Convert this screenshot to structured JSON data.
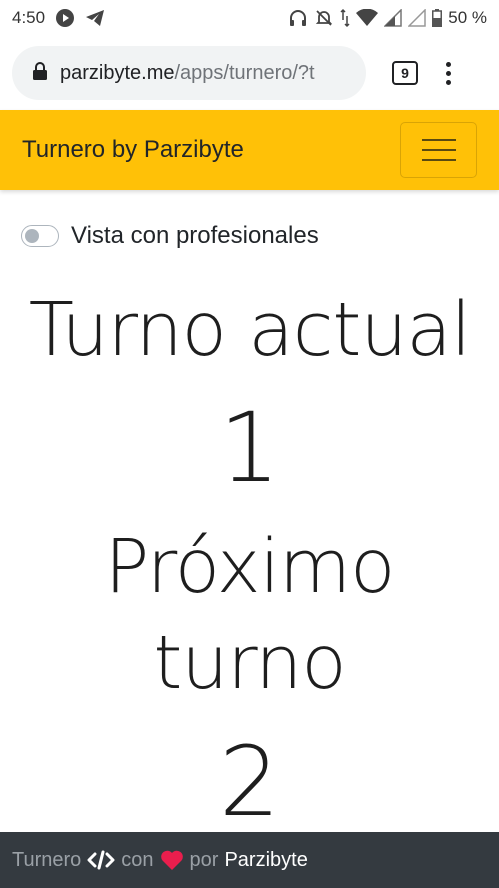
{
  "status_bar": {
    "time": "4:50",
    "battery": "50 %"
  },
  "browser": {
    "url_domain": "parzibyte.me",
    "url_path": "/apps/turnero/?t",
    "tab_count": "9"
  },
  "navbar": {
    "brand": "Turnero by Parzibyte"
  },
  "toggle": {
    "label": "Vista con profesionales",
    "checked": false
  },
  "main": {
    "current_title": "Turno actual",
    "current_number": "1",
    "next_title_line1": "Próximo",
    "next_title_line2": "turno",
    "next_number": "2"
  },
  "footer": {
    "app": "Turnero",
    "con": "con",
    "por": "por",
    "author": "Parzibyte"
  },
  "colors": {
    "navbar": "#ffc107",
    "footer": "#343a40",
    "heart": "#e91e4d"
  }
}
